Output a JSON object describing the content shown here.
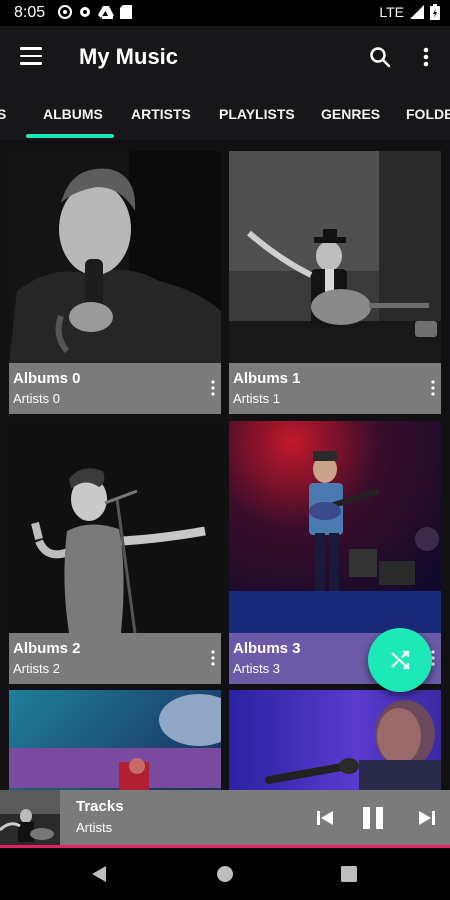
{
  "status_bar": {
    "time": "8:05",
    "network": "LTE"
  },
  "app_bar": {
    "title": "My Music"
  },
  "tabs": [
    {
      "label": "S"
    },
    {
      "label": "ALBUMS"
    },
    {
      "label": "ARTISTS"
    },
    {
      "label": "PLAYLISTS"
    },
    {
      "label": "GENRES"
    },
    {
      "label": "FOLDERS"
    }
  ],
  "albums": [
    {
      "name": "Albums 0",
      "artist": "Artists 0",
      "info_color": "#7b7b7b"
    },
    {
      "name": "Albums 1",
      "artist": "Artists 1",
      "info_color": "#7b7b7b"
    },
    {
      "name": "Albums 2",
      "artist": "Artists 2",
      "info_color": "#7b7b7b"
    },
    {
      "name": "Albums 3",
      "artist": "Artists 3",
      "info_color": "#6a5aa8"
    },
    {
      "name": "",
      "artist": ""
    },
    {
      "name": "",
      "artist": ""
    }
  ],
  "now_playing": {
    "title": "Tracks",
    "artist": "Artists"
  },
  "colors": {
    "accent": "#1de9b6",
    "progress": "#e91e63",
    "card_info": "#7b7b7b",
    "app_bar": "#17171a"
  },
  "icons": [
    "menu-icon",
    "search-icon",
    "more-vert-icon",
    "shuffle-icon",
    "skip-previous-icon",
    "pause-icon",
    "skip-next-icon",
    "nav-back-icon",
    "nav-home-icon",
    "nav-recents-icon"
  ]
}
